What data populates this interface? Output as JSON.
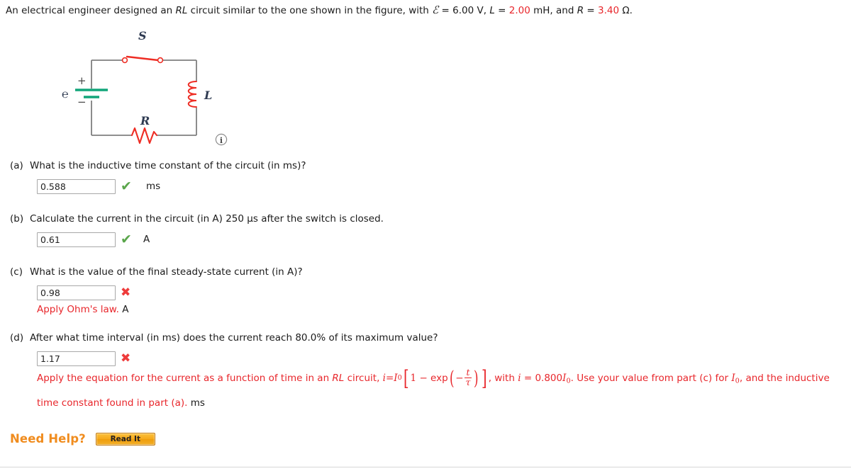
{
  "problem": {
    "intro_a": "An electrical engineer designed an ",
    "intro_rl": "RL",
    "intro_b": " circuit similar to the one shown in the figure, with ",
    "emf_symbol": "ℰ",
    "emf_eq": " = 6.00 V, ",
    "inductance_symbol": "L",
    "inductance_eq_prefix": " = ",
    "inductance_value": "2.00",
    "inductance_unit": " mH, and ",
    "resistance_symbol": "R",
    "resistance_eq_prefix": " = ",
    "resistance_value": "3.40",
    "resistance_unit": " Ω."
  },
  "figure": {
    "label_switch": "S",
    "label_inductor": "L",
    "label_resistor": "R",
    "label_emf": "ℰ",
    "label_plus": "+",
    "label_minus": "−",
    "info_icon": "i",
    "colors": {
      "wire": "#7f7f7f",
      "component_red": "#ee2d24",
      "battery_green": "#12a57a",
      "label_dark": "#2f3b52"
    }
  },
  "parts": [
    {
      "label": "(a)",
      "question": "What is the inductive time constant of the circuit (in ms)?",
      "answer": "0.588",
      "status": "correct",
      "unit": "ms"
    },
    {
      "label": "(b)",
      "question": "Calculate the current in the circuit (in A) 250 μs after the switch is closed.",
      "answer": "0.61",
      "status": "correct",
      "unit": "A"
    },
    {
      "label": "(c)",
      "question": "What is the value of the final steady-state current (in A)?",
      "answer": "0.98",
      "status": "incorrect",
      "unit": "",
      "feedback_text": "Apply Ohm's law.",
      "feedback_unit": "A"
    },
    {
      "label": "(d)",
      "question": "After what time interval (in ms) does the current reach 80.0% of its maximum value?",
      "answer": "1.17",
      "status": "incorrect",
      "unit": "",
      "feedback_lead": "Apply the equation for the current as a function of time in an ",
      "feedback_rl": "RL",
      "feedback_circuit": " circuit, ",
      "feedback_eq_i": "i",
      "feedback_eq_equals": " = ",
      "feedback_eq_I": "I",
      "feedback_eq_I_sub": "0",
      "feedback_eq_one": "1",
      "feedback_eq_minus": "−",
      "feedback_eq_exp": "exp",
      "feedback_eq_negsign": "−",
      "feedback_eq_t": "t",
      "feedback_eq_tau": "τ",
      "feedback_mid": ", with ",
      "feedback_cond_i": "i",
      "feedback_cond_equals": " = ",
      "feedback_cond_val": "0.800",
      "feedback_cond_I": "I",
      "feedback_cond_I_sub": "0",
      "feedback_tail": ". Use your value from part (c) for ",
      "feedback_tail_I": "I",
      "feedback_tail_I_sub": "0",
      "feedback_tail2": ", and the inductive",
      "feedback_line2": "time constant found in part (a).",
      "feedback_unit": "ms"
    }
  ],
  "marks": {
    "correct_glyph": "✔",
    "incorrect_glyph": "✖",
    "correct_color": "#5aa64b",
    "incorrect_color": "#ee3b3b"
  },
  "need_help": {
    "label": "Need Help?",
    "button_label": "Read It"
  }
}
